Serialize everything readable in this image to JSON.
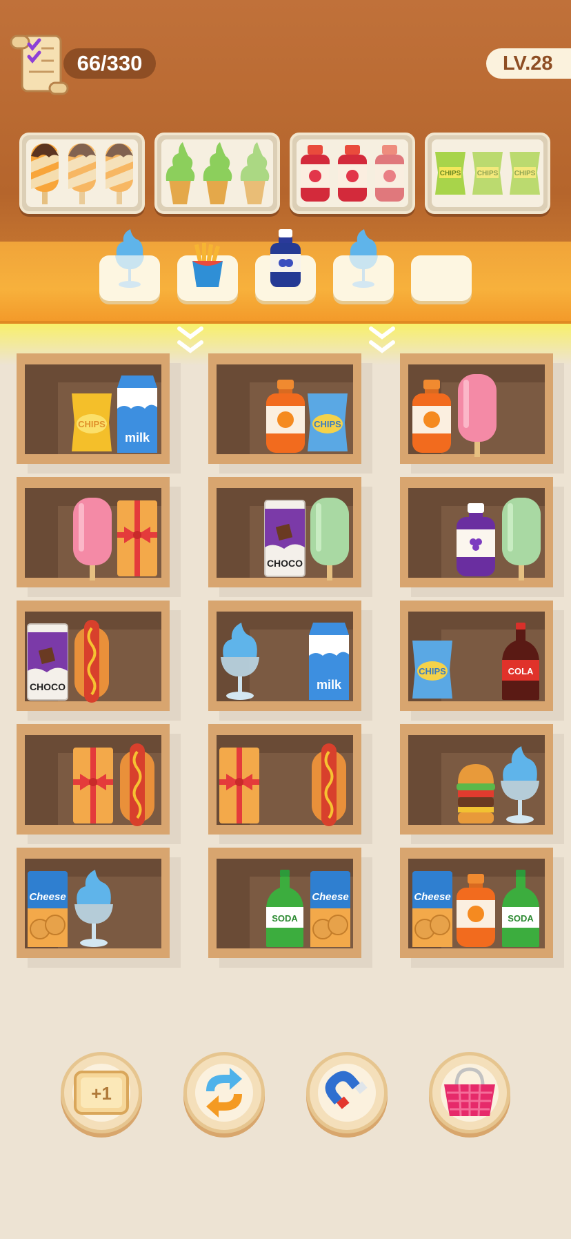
{
  "header": {
    "progress": "66/330",
    "level": "LV.28",
    "progress_value": 66,
    "progress_total": 330
  },
  "orders": [
    {
      "item": "popsicle-swirl-icon",
      "count": 3
    },
    {
      "item": "green-soft-serve-icon",
      "count": 3
    },
    {
      "item": "strawberry-jam-icon",
      "count": 3
    },
    {
      "item": "chips-green-bag-icon",
      "count": 3
    }
  ],
  "order_labels": {
    "chips": "CHIPS"
  },
  "collection_slots": [
    "blue-sundae-icon",
    "fries-icon",
    "blueberry-jam-icon",
    "blue-sundae-icon",
    "empty"
  ],
  "item_labels": {
    "chips": "CHIPS",
    "milk": "milk",
    "choco": "CHOCO",
    "cola": "COLA",
    "soda": "SODA",
    "cheese": "Cheese"
  },
  "shelves": [
    [
      "chips-yellow-icon",
      "milk-carton-icon"
    ],
    [
      "orange-juice-icon",
      "chips-blue-icon"
    ],
    [
      "orange-juice-icon",
      "pink-popsicle-icon"
    ],
    [
      "pink-popsicle-icon",
      "gift-box-icon"
    ],
    [
      "choco-drink-icon",
      "green-popsicle-icon"
    ],
    [
      "grape-juice-icon",
      "green-popsicle-icon"
    ],
    [
      "choco-drink-icon",
      "hotdog-icon"
    ],
    [
      "blue-sundae-icon",
      "milk-carton-icon"
    ],
    [
      "chips-blue-icon",
      "cola-bottle-icon"
    ],
    [
      "gift-box-icon",
      "hotdog-icon"
    ],
    [
      "gift-box-icon",
      "hotdog-icon"
    ],
    [
      "burger-icon",
      "blue-sundae-icon"
    ],
    [
      "cheese-crackers-icon",
      "blue-sundae-icon"
    ],
    [
      "soda-bottle-icon",
      "cheese-crackers-icon"
    ],
    [
      "cheese-crackers-icon",
      "orange-juice-icon",
      "soda-bottle-icon"
    ]
  ],
  "boosters": {
    "add_slot": "+1",
    "names": [
      "add-slot-icon",
      "shuffle-icon",
      "magnet-icon",
      "basket-icon"
    ]
  },
  "colors": {
    "header": "#b5652c",
    "band": "#f7b13c",
    "shelf": "#d8a56f",
    "background": "#ede3d3"
  }
}
